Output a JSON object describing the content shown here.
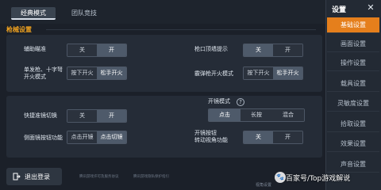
{
  "tabs": {
    "active": "经典模式",
    "inactive": "团队竞技"
  },
  "section_title": "枪械设置",
  "panel1": {
    "assist_aim": {
      "label": "辅助瞄准",
      "off": "关",
      "on": "开"
    },
    "muzzle_tip": {
      "label": "枪口顶墙提示",
      "off": "关",
      "on": "开"
    },
    "fire_mode": {
      "label_line1": "单发枪、十字弩",
      "label_line2": "开火模式",
      "press": "按下开火",
      "release": "松手开火"
    },
    "burst_mode": {
      "label": "霰弹枪开火模式",
      "press": "按下开火",
      "release": "松手开火"
    }
  },
  "panel2": {
    "scope_mode": {
      "label": "开镜模式",
      "tap": "点击",
      "hold": "长按",
      "mixed": "混合"
    },
    "quick_scope": {
      "label": "快捷准镜切换",
      "off": "关",
      "on": "开"
    },
    "side_scope": {
      "label": "侧面镜按钮功能",
      "open": "点击开镜",
      "switch": "点击切镜"
    },
    "scope_view": {
      "label_line1": "开镜按钮",
      "label_line2": "转动视角功能",
      "off": "关",
      "on": "开"
    }
  },
  "logout_label": "退出登录",
  "footer_links": [
    "腾讯游戏许可及服务协议",
    "腾讯游戏隐私保护指引"
  ],
  "sidebar": {
    "title": "设置",
    "items": [
      "基础设置",
      "画面设置",
      "操作设置",
      "载具设置",
      "灵敏度设置",
      "拾取设置",
      "效果设置",
      "声音设置"
    ],
    "active_index": 0
  },
  "bottom_extra": "视角设置",
  "watermark": "百家号/Top游戏解说"
}
